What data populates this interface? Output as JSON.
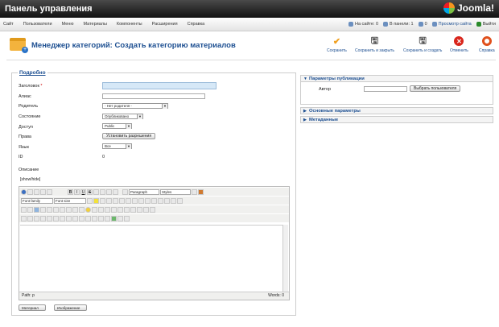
{
  "header": {
    "site_title": "Панель управления",
    "logo_text": "Joomla!"
  },
  "menu": [
    "Сайт",
    "Пользователи",
    "Меню",
    "Материалы",
    "Компоненты",
    "Расширения",
    "Справка"
  ],
  "status": {
    "on_site": "На сайте: 0",
    "in_panel": "В панели: 1",
    "messages": "0",
    "view_site": "Просмотр сайта",
    "logout": "Выйти"
  },
  "page_title": "Менеджер категорий: Создать категорию материалов",
  "toolbar": {
    "save": "Сохранить",
    "save_close": "Сохранить и закрыть",
    "save_new": "Сохранить и создать",
    "cancel": "Отменить",
    "help": "Справка"
  },
  "form": {
    "legend": "Подробно",
    "title_label": "Заголовок",
    "required_mark": "*",
    "alias_label": "Алиас",
    "parent_label": "Родитель",
    "parent_value": "- Нет родителя -",
    "state_label": "Состояние",
    "state_value": "Опубликовано",
    "access_label": "Доступ",
    "access_value": "Public",
    "rights_label": "Права",
    "rights_button": "Установить разрешения",
    "language_label": "Язык",
    "language_value": "Все",
    "id_label": "ID",
    "id_value": "0",
    "description_label": "Описание",
    "toggle_editor": "[show/hide]"
  },
  "editor": {
    "bold": "B",
    "italic": "I",
    "underline": "U",
    "strike": "S",
    "format_value": "Paragraph",
    "styles_value": "Styles",
    "font_family": "Font family",
    "font_size": "Font size",
    "path_label": "Path:",
    "path_value": "p",
    "words": "Words: 0"
  },
  "extra_buttons": {
    "article": "Материал",
    "image": "Изображение"
  },
  "sidebar": {
    "publish_title": "Параметры публикации",
    "author_label": "Автор",
    "select_user": "Выбрать пользователя",
    "basic_title": "Основные параметры",
    "meta_title": "Метаданные"
  },
  "colors": {
    "accent": "#1d4f91",
    "title_field_bg": "#d6e8f7",
    "save_icon": "#f0a020",
    "cancel_icon": "#d9261c"
  }
}
